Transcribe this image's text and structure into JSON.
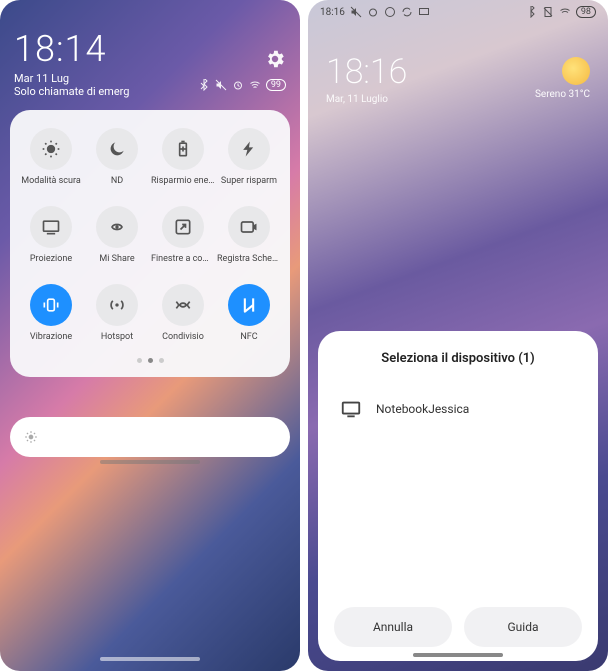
{
  "left": {
    "clock": "18:14",
    "date": "Mar 11 Lug",
    "carrier": "Solo chiamate di emerg",
    "battery": "99",
    "tiles": [
      {
        "label": "Modalità scura",
        "icon": "dark-mode-icon",
        "on": false
      },
      {
        "label": "ND",
        "icon": "moon-icon",
        "on": false
      },
      {
        "label": "Risparmio energet",
        "icon": "battery-saver-icon",
        "on": false
      },
      {
        "label": "Super risparm",
        "icon": "bolt-icon",
        "on": false
      },
      {
        "label": "Proiezione",
        "icon": "cast-icon",
        "on": false
      },
      {
        "label": "Mi Share",
        "icon": "mishare-icon",
        "on": false
      },
      {
        "label": "Finestre a compar",
        "icon": "popup-window-icon",
        "on": false
      },
      {
        "label": "Registra Schermo",
        "icon": "screen-record-icon",
        "on": false
      },
      {
        "label": "Vibrazione",
        "icon": "vibrate-icon",
        "on": true
      },
      {
        "label": "Hotspot",
        "icon": "hotspot-icon",
        "on": false
      },
      {
        "label": "Condivisio",
        "icon": "share-icon",
        "on": false
      },
      {
        "label": "NFC",
        "icon": "nfc-icon",
        "on": true
      }
    ]
  },
  "right": {
    "status_time": "18:16",
    "battery": "98",
    "clock": "18:16",
    "date": "Mar, 11 Luglio",
    "weather_label": "Sereno",
    "weather_temp": "31°C",
    "sheet_title": "Seleziona il dispositivo (1)",
    "device": "NotebookJessica",
    "btn_cancel": "Annulla",
    "btn_guide": "Guida"
  }
}
